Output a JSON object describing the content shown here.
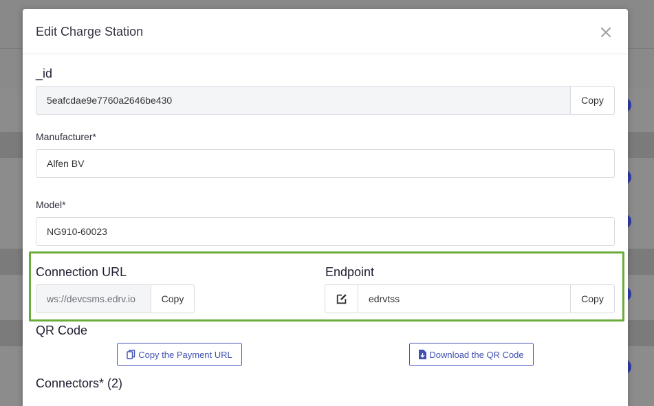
{
  "modal": {
    "title": "Edit Charge Station",
    "close_glyph": "×"
  },
  "fields": {
    "id": {
      "label": "_id",
      "value": "5eafcdae9e7760a2646be430",
      "copy_label": "Copy"
    },
    "manufacturer": {
      "label": "Manufacturer*",
      "value": "Alfen BV"
    },
    "model": {
      "label": "Model*",
      "value": "NG910-60023"
    }
  },
  "connection": {
    "label": "Connection URL",
    "value": "ws://devcsms.edrv.io",
    "copy_label": "Copy"
  },
  "endpoint": {
    "label": "Endpoint",
    "value": "edrvtss",
    "copy_label": "Copy",
    "edit_icon": "edit-icon"
  },
  "qr": {
    "label": "QR Code",
    "copy_payment_label": "Copy the Payment URL",
    "download_label": "Download the QR Code",
    "copy_icon": "copy-icon",
    "download_icon": "file-download-icon"
  },
  "connectors": {
    "label": "Connectors* (2)"
  },
  "colors": {
    "accent": "#3f51b5",
    "highlight": "#6aab3a",
    "overlay": "#8a8a8a"
  }
}
